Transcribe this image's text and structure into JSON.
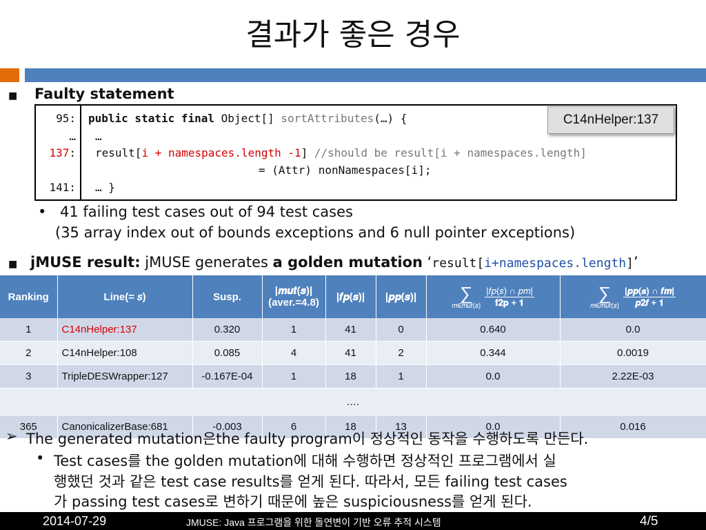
{
  "title": "결과가 좋은 경우",
  "faulty": {
    "heading": "Faulty statement",
    "callout": "C14nHelper:137",
    "code": {
      "l1_num": "95:",
      "l1_kw": "public static final",
      "l1_a": " Object[] ",
      "l1_method": "sortAttributes",
      "l1_b": "(…) {",
      "l2_num": "…",
      "l2": "…",
      "l3_num": "137",
      "l3_colon": ":",
      "l3_a": "result[",
      "l3_red": "i + namespaces.length -1",
      "l3_b": "] ",
      "l3_comment": "//should be result[i + namespaces.length]",
      "l4": "= (Attr) nonNamespaces[i];",
      "l5_num": "141:",
      "l5": "… }"
    },
    "note_line1": "41 failing test cases out of 94 test cases",
    "note_line2": "(35 array index out of bounds exceptions and 6 null pointer exceptions)"
  },
  "jmuse": {
    "label": "jMUSE result:",
    "text": " jMUSE generates ",
    "bold": "a golden mutation",
    "q_open": " ‘",
    "code_a": "result[",
    "code_b": "i+namespaces.length",
    "code_c": "]",
    "q_close": "’"
  },
  "chart_data": {
    "type": "table",
    "columns": [
      "Ranking",
      "Line(= s)",
      "Susp.",
      "|mut(s)| (aver.=4.8)",
      "|f_p(s)|",
      "|p_p(s)|",
      "Σ_{m∈mut(s)} |f_p(s) ∩ p_m| / f2p+1",
      "Σ_{m∈mut(s)} |p_p(s) ∩ f_m| / p2f+1"
    ],
    "rows": [
      [
        "1",
        "C14nHelper:137",
        "0.320",
        "1",
        "41",
        "0",
        "0.640",
        "0.0"
      ],
      [
        "2",
        "C14nHelper:108",
        "0.085",
        "4",
        "41",
        "2",
        "0.344",
        "0.0019"
      ],
      [
        "3",
        "TripleDESWrapper:127",
        "-0.167E-04",
        "1",
        "18",
        "1",
        "0.0",
        "2.22E-03"
      ],
      [
        "…."
      ],
      [
        "365",
        "CanonicalizerBase:681",
        "-0.003",
        "6",
        "18",
        "13",
        "0.0",
        "0.016"
      ]
    ]
  },
  "table_head": {
    "ranking": "Ranking",
    "line": "Line(= 𝑠)",
    "susp": "Susp.",
    "mut1": "|𝒎𝒖𝒕(𝒔)|",
    "mut2": "(aver.=4.8)",
    "fp": "|𝒇𝒑(𝒔)|",
    "pp": "|𝒑𝒑(𝒔)|",
    "s1_num": "|𝑓𝑝(𝑠) ∩ 𝑝𝑚|",
    "s1_den": "𝐟𝟐𝐩 + 𝟏",
    "s1_sub": "𝑚∈𝑚𝑢𝑡(𝑠)",
    "s2_num": "|𝒑𝒑(𝒔) ∩ 𝒇𝒎|",
    "s2_den": "𝒑𝟐𝒇 + 𝟏",
    "s2_sub": "𝑚∈𝑚𝑢𝑡(𝑠)",
    "sigma": "∑"
  },
  "rows": [
    {
      "rank": "1",
      "line": "C14nHelper:137",
      "susp": "0.320",
      "mut": "1",
      "fp": "41",
      "pp": "0",
      "s1": "0.640",
      "s2": "0.0"
    },
    {
      "rank": "2",
      "line": "C14nHelper:108",
      "susp": "0.085",
      "mut": "4",
      "fp": "41",
      "pp": "2",
      "s1": "0.344",
      "s2": "0.0019"
    },
    {
      "rank": "3",
      "line": "TripleDESWrapper:127",
      "susp": "-0.167E-04",
      "mut": "1",
      "fp": "18",
      "pp": "1",
      "s1": "0.0",
      "s2": "2.22E-03"
    },
    {
      "ellipsis": "…."
    },
    {
      "rank": "365",
      "line": "CanonicalizerBase:681",
      "susp": "-0.003",
      "mut": "6",
      "fp": "18",
      "pp": "13",
      "s1": "0.0",
      "s2": "0.016"
    }
  ],
  "conclusion": {
    "line1": "The generated mutation은the faulty program이 정상적인 동작을 수행하도록 만든다.",
    "sub1": "Test cases를 the golden mutation에 대해 수행하면 정상적인 프로그램에서 실",
    "sub2": "행했던 것과 같은 test case results를 얻게 된다. 따라서, 모든 failing test cases",
    "sub3": "가  passing test cases로 변하기 때문에 높은 suspiciousness를 얻게 된다."
  },
  "footer": {
    "date": "2014-07-29",
    "center": "JMUSE: Java 프로그램을 위한 돌연변이 기반 오류 추적 시스템",
    "page": "4/5"
  },
  "colors": {
    "accent_blue": "#4f81bd",
    "accent_orange": "#e36c09",
    "row_odd": "#d0d8e8",
    "row_even": "#e9edf4",
    "code_red": "#d40000"
  }
}
